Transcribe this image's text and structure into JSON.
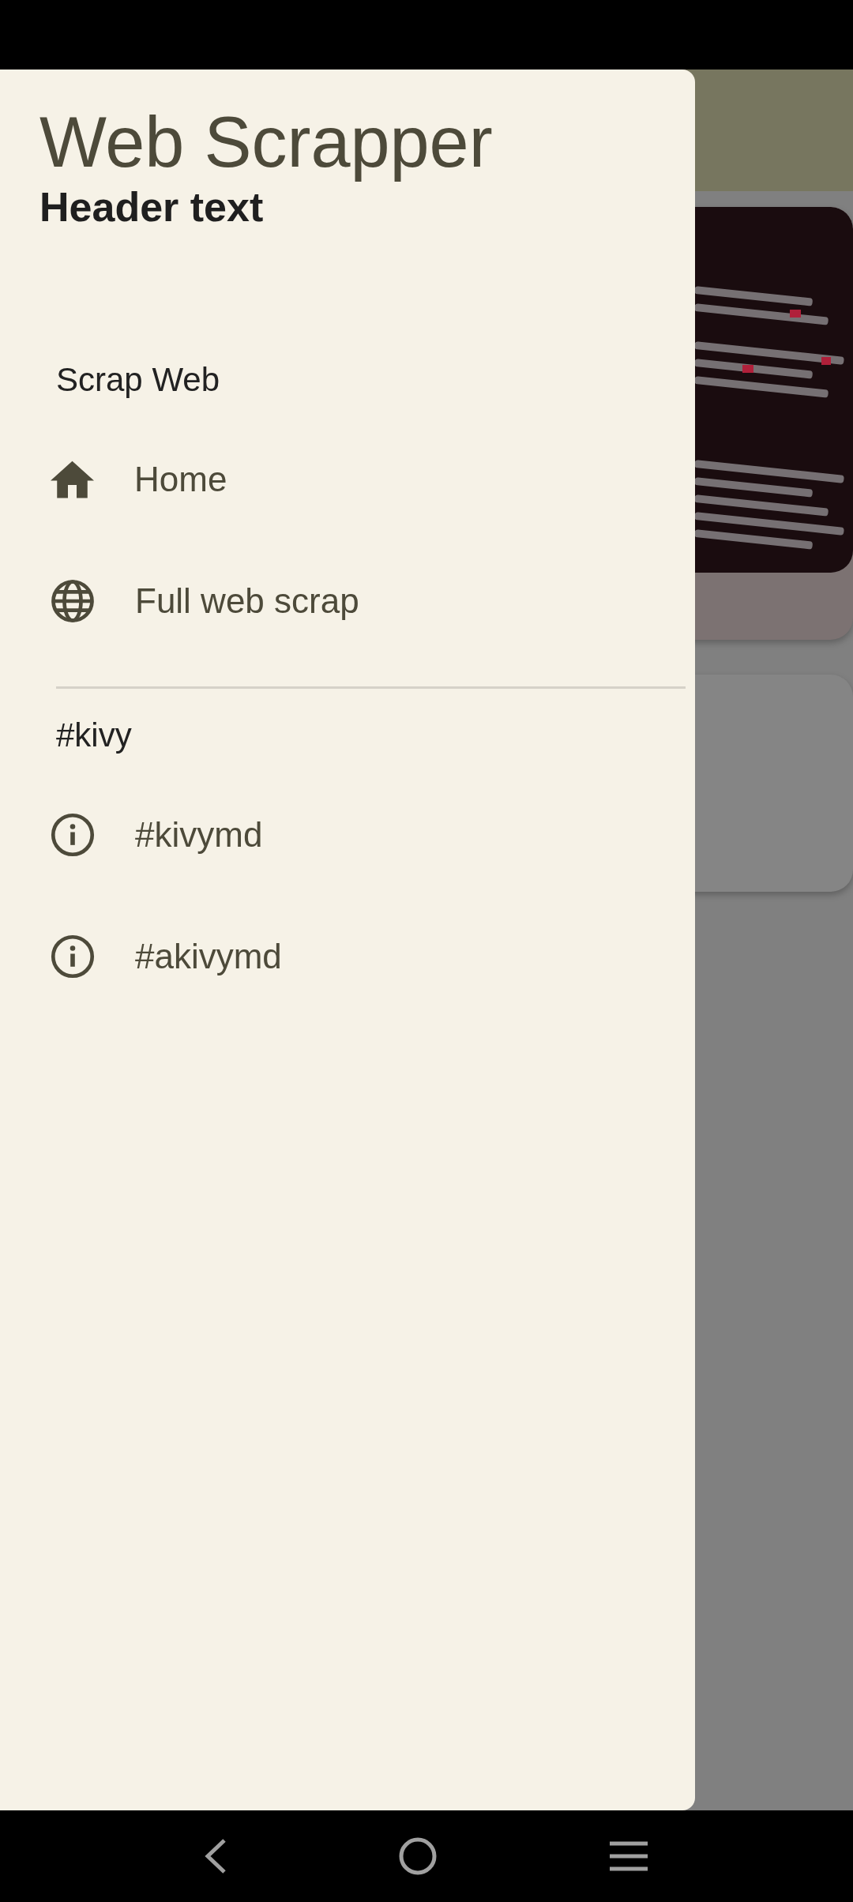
{
  "drawer": {
    "title": "Web Scrapper",
    "subtitle": "Header text",
    "sections": [
      {
        "label": "Scrap Web",
        "items": [
          {
            "label": "Home",
            "kind": "home"
          },
          {
            "label": "Full web scrap",
            "kind": "globe"
          }
        ]
      },
      {
        "label": "#kivy",
        "items": [
          {
            "label": "#kivymd",
            "kind": "info"
          },
          {
            "label": "#akivymd",
            "kind": "info"
          }
        ]
      }
    ]
  },
  "background": {
    "cards": [
      {
        "kind": "picture"
      },
      {
        "kind": "blank"
      }
    ]
  }
}
